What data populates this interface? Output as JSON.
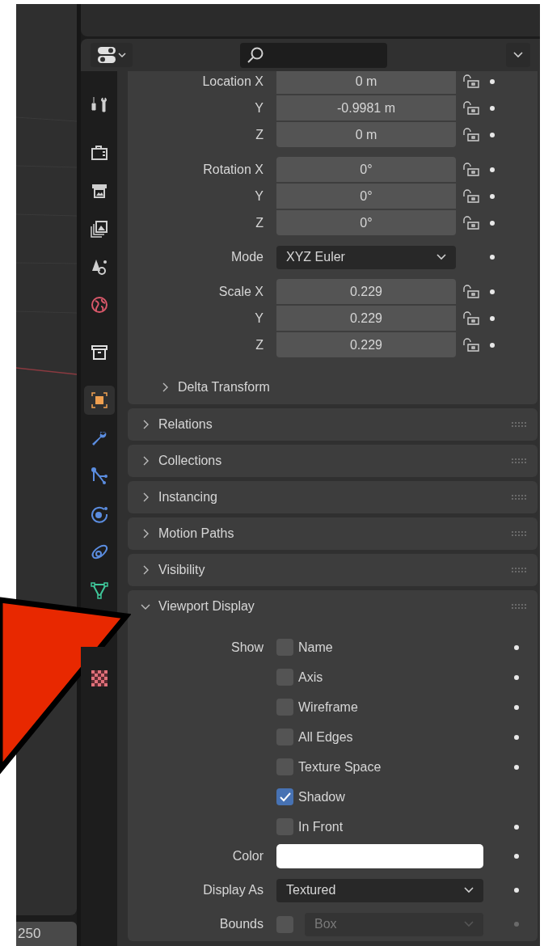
{
  "viewport": {
    "frame_field": "250"
  },
  "tab_groups": [
    [
      {
        "kind": "tool",
        "selected": false
      }
    ],
    [
      {
        "kind": "render",
        "selected": false
      },
      {
        "kind": "output",
        "selected": false
      },
      {
        "kind": "view_layer",
        "selected": false
      },
      {
        "kind": "scene",
        "selected": false
      },
      {
        "kind": "world",
        "selected": false
      }
    ],
    [
      {
        "kind": "collection",
        "selected": false
      }
    ],
    [
      {
        "kind": "object",
        "selected": true
      },
      {
        "kind": "modifier",
        "selected": false
      },
      {
        "kind": "particles",
        "selected": false
      },
      {
        "kind": "physics",
        "selected": false
      },
      {
        "kind": "constraints",
        "selected": false
      },
      {
        "kind": "data",
        "selected": false
      },
      {
        "kind": "material",
        "selected": false
      }
    ]
  ],
  "transform": {
    "groups": [
      {
        "kind": "vector",
        "rows": [
          {
            "label": "Location X",
            "value": "0 m"
          },
          {
            "label": "Y",
            "value": "-0.9981 m"
          },
          {
            "label": "Z",
            "value": "0 m"
          }
        ]
      },
      {
        "kind": "vector",
        "rows": [
          {
            "label": "Rotation X",
            "value": "0°"
          },
          {
            "label": "Y",
            "value": "0°"
          },
          {
            "label": "Z",
            "value": "0°"
          }
        ]
      },
      {
        "kind": "dropdown",
        "rows": [
          {
            "label": "Mode",
            "value": "XYZ Euler"
          }
        ]
      },
      {
        "kind": "vector",
        "rows": [
          {
            "label": "Scale X",
            "value": "0.229"
          },
          {
            "label": "Y",
            "value": "0.229"
          },
          {
            "label": "Z",
            "value": "0.229"
          }
        ]
      }
    ],
    "subpanel": {
      "title": "Delta Transform",
      "expanded": false
    }
  },
  "panels": [
    {
      "title": "Relations",
      "expanded": false
    },
    {
      "title": "Collections",
      "expanded": false
    },
    {
      "title": "Instancing",
      "expanded": false
    },
    {
      "title": "Motion Paths",
      "expanded": false
    },
    {
      "title": "Visibility",
      "expanded": false
    },
    {
      "title": "Viewport Display",
      "expanded": true
    }
  ],
  "viewport_display": {
    "show_label": "Show",
    "options": [
      {
        "label": "Name",
        "checked": false,
        "animatable": true
      },
      {
        "label": "Axis",
        "checked": false,
        "animatable": true
      },
      {
        "label": "Wireframe",
        "checked": false,
        "animatable": true
      },
      {
        "label": "All Edges",
        "checked": false,
        "animatable": true
      },
      {
        "label": "Texture Space",
        "checked": false,
        "animatable": true
      },
      {
        "label": "Shadow",
        "checked": true,
        "animatable": false
      },
      {
        "label": "In Front",
        "checked": false,
        "animatable": true
      }
    ],
    "color": {
      "label": "Color",
      "color": "#ffffff"
    },
    "display_as": {
      "label": "Display As",
      "value": "Textured"
    },
    "bounds": {
      "label": "Bounds",
      "checked": false,
      "value": "Box",
      "disabled": true
    }
  }
}
